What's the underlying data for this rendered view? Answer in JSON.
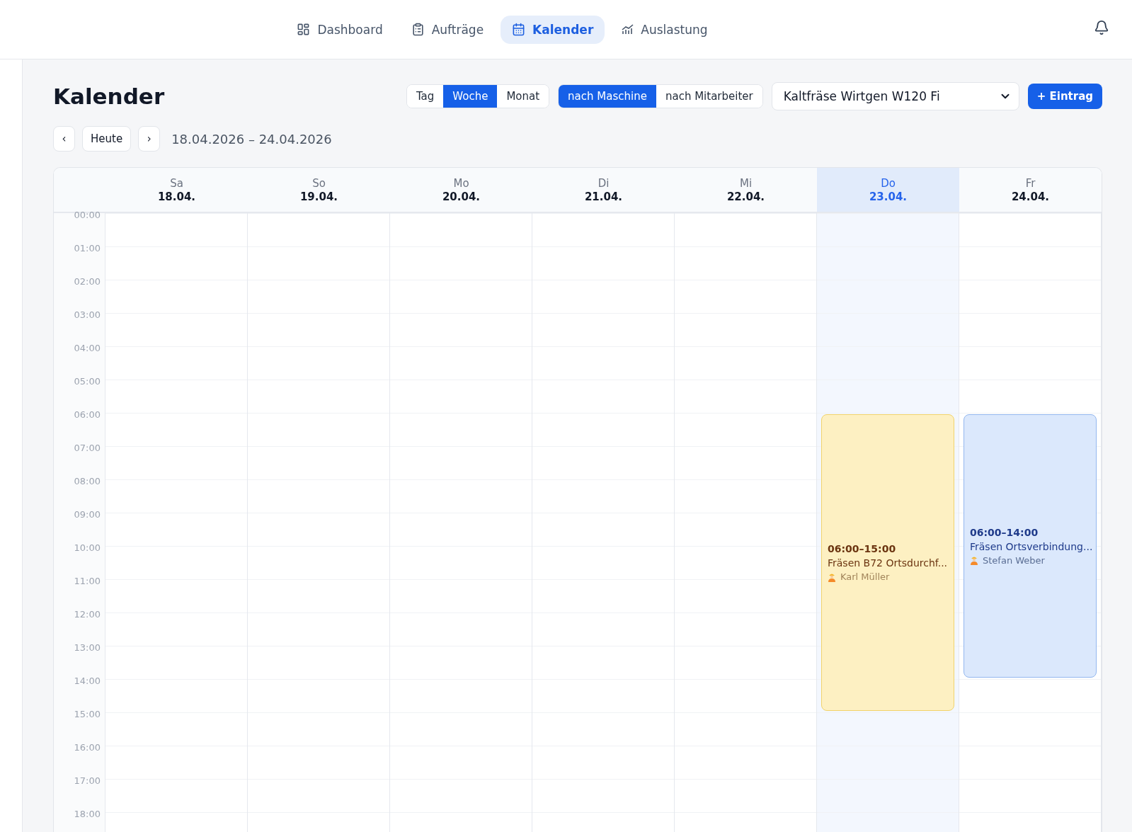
{
  "nav": {
    "items": [
      {
        "label": "Dashboard",
        "selected": false
      },
      {
        "label": "Aufträge",
        "selected": false
      },
      {
        "label": "Kalender",
        "selected": true
      },
      {
        "label": "Auslastung",
        "selected": false
      }
    ]
  },
  "page": {
    "title": "Kalender"
  },
  "view_switch": [
    {
      "label": "Tag",
      "selected": false
    },
    {
      "label": "Woche",
      "selected": true
    },
    {
      "label": "Monat",
      "selected": false
    }
  ],
  "group_switch": [
    {
      "label": "nach Maschine",
      "selected": true
    },
    {
      "label": "nach Mitarbeiter",
      "selected": false
    }
  ],
  "machine_select": {
    "value": "Kaltfräse Wirtgen W120 Fi"
  },
  "add_button": {
    "label": "+ Eintrag"
  },
  "date_nav": {
    "prev": "‹",
    "today": "Heute",
    "next": "›",
    "range": "18.04.2026 – 24.04.2026"
  },
  "calendar": {
    "hours": [
      "00:00",
      "01:00",
      "02:00",
      "03:00",
      "04:00",
      "05:00",
      "06:00",
      "07:00",
      "08:00",
      "09:00",
      "10:00",
      "11:00",
      "12:00",
      "13:00",
      "14:00",
      "15:00",
      "16:00",
      "17:00",
      "18:00"
    ],
    "days": [
      {
        "weekday": "Sa",
        "date": "18.04.",
        "today": false
      },
      {
        "weekday": "So",
        "date": "19.04.",
        "today": false
      },
      {
        "weekday": "Mo",
        "date": "20.04.",
        "today": false
      },
      {
        "weekday": "Di",
        "date": "21.04.",
        "today": false
      },
      {
        "weekday": "Mi",
        "date": "22.04.",
        "today": false
      },
      {
        "weekday": "Do",
        "date": "23.04.",
        "today": true,
        "events": [
          {
            "time": "06:00–15:00",
            "title": "Fräsen B72 Ortsdurchf...",
            "person": "Karl Müller",
            "color": "#fdf0c2"
          }
        ]
      },
      {
        "weekday": "Fr",
        "date": "24.04.",
        "today": false,
        "events": [
          {
            "time": "06:00–14:00",
            "title": "Fräsen Ortsverbindung...",
            "person": "Stefan Weber",
            "color": "#dbe8fc"
          }
        ]
      }
    ]
  }
}
